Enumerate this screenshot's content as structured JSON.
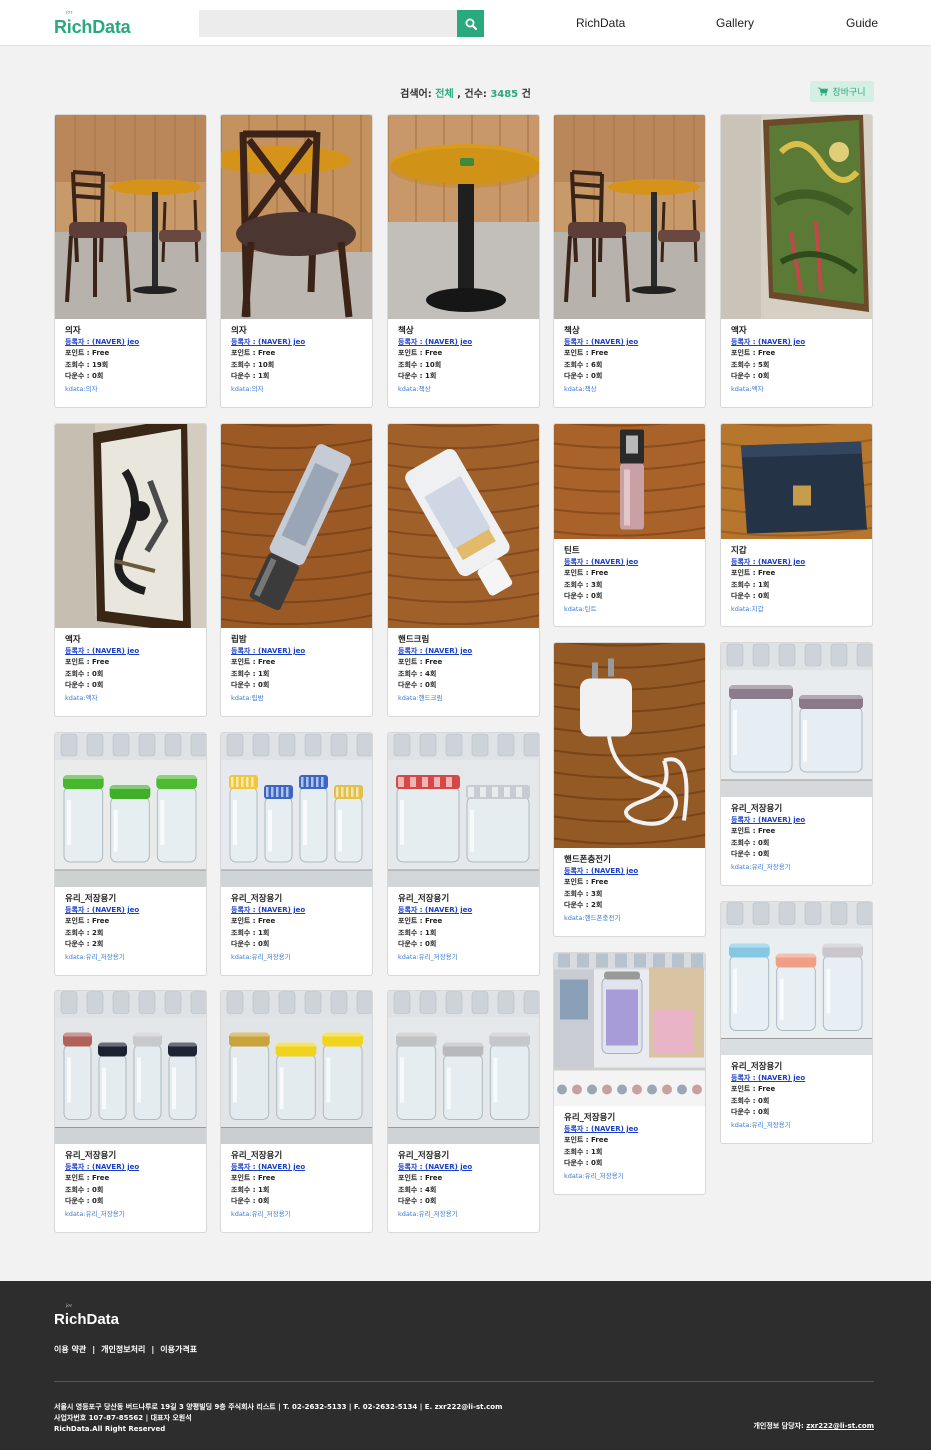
{
  "header": {
    "logo_sprout": "ʲᵒᶦ",
    "logo_text": "RichData",
    "search_placeholder": "",
    "nav": [
      "RichData",
      "Gallery",
      "Guide"
    ]
  },
  "summary": {
    "query_label": "검색어:",
    "query_value": "전체",
    "count_label": ", 건수:",
    "count_value": "3485",
    "count_unit": "건"
  },
  "cart_label": "장바구니",
  "cards": [
    {
      "title": "의자",
      "reg": "등록자 : (NAVER) jeo",
      "point": "포인트 : Free",
      "views": "조회수 : 19회",
      "downloads": "다운수 : 0회",
      "tag": "kdata:의자",
      "photo": "cafe-chair"
    },
    {
      "title": "의자",
      "reg": "등록자 : (NAVER) jeo",
      "point": "포인트 : Free",
      "views": "조회수 : 10회",
      "downloads": "다운수 : 1회",
      "tag": "kdata:의자",
      "photo": "cross-chair"
    },
    {
      "title": "책상",
      "reg": "등록자 : (NAVER) jeo",
      "point": "포인트 : Free",
      "views": "조회수 : 10회",
      "downloads": "다운수 : 1회",
      "tag": "kdata:책상",
      "photo": "round-table"
    },
    {
      "title": "책상",
      "reg": "등록자 : (NAVER) jeo",
      "point": "포인트 : Free",
      "views": "조회수 : 6회",
      "downloads": "다운수 : 0회",
      "tag": "kdata:책상",
      "photo": "cafe-chair"
    },
    {
      "title": "액자",
      "reg": "등록자 : (NAVER) jeo",
      "point": "포인트 : Free",
      "views": "조회수 : 5회",
      "downloads": "다운수 : 0회",
      "tag": "kdata:액자",
      "photo": "painting"
    },
    {
      "title": "액자",
      "reg": "등록자 : (NAVER) jeo",
      "point": "포인트 : Free",
      "views": "조회수 : 0회",
      "downloads": "다운수 : 0회",
      "tag": "kdata:액자",
      "photo": "frame-art"
    },
    {
      "title": "립밤",
      "reg": "등록자 : (NAVER) jeo",
      "point": "포인트 : Free",
      "views": "조회수 : 1회",
      "downloads": "다운수 : 0회",
      "tag": "kdata:립밤",
      "photo": "lip-balm"
    },
    {
      "title": "핸드크림",
      "reg": "등록자 : (NAVER) jeo",
      "point": "포인트 : Free",
      "views": "조회수 : 4회",
      "downloads": "다운수 : 0회",
      "tag": "kdata:핸드크림",
      "photo": "hand-cream"
    },
    {
      "title": "틴트",
      "reg": "등록자 : (NAVER) jeo",
      "point": "포인트 : Free",
      "views": "조회수 : 3회",
      "downloads": "다운수 : 0회",
      "tag": "kdata:틴트",
      "photo": "tint"
    },
    {
      "title": "지갑",
      "reg": "등록자 : (NAVER) jeo",
      "point": "포인트 : Free",
      "views": "조회수 : 1회",
      "downloads": "다운수 : 0회",
      "tag": "kdata:지갑",
      "photo": "wallet"
    },
    {
      "title": "핸드폰충전기",
      "reg": "등록자 : (NAVER) jeo",
      "point": "포인트 : Free",
      "views": "조회수 : 3회",
      "downloads": "다운수 : 2회",
      "tag": "kdata:핸드폰충전기",
      "photo": "charger"
    },
    {
      "title": "유리_저장용기",
      "reg": "등록자 : (NAVER) jeo",
      "point": "포인트 : Free",
      "views": "조회수 : 0회",
      "downloads": "다운수 : 0회",
      "tag": "kdata:유리_저장용기",
      "photo": "jar-purple"
    },
    {
      "title": "유리_저장용기",
      "reg": "등록자 : (NAVER) jeo",
      "point": "포인트 : Free",
      "views": "조회수 : 2회",
      "downloads": "다운수 : 2회",
      "tag": "kdata:유리_저장용기",
      "photo": "jar-green"
    },
    {
      "title": "유리_저장용기",
      "reg": "등록자 : (NAVER) jeo",
      "point": "포인트 : Free",
      "views": "조회수 : 1회",
      "downloads": "다운수 : 0회",
      "tag": "kdata:유리_저장용기",
      "photo": "jar-blue-check"
    },
    {
      "title": "유리_저장용기",
      "reg": "등록자 : (NAVER) jeo",
      "point": "포인트 : Free",
      "views": "조회수 : 1회",
      "downloads": "다운수 : 0회",
      "tag": "kdata:유리_저장용기",
      "photo": "jar-red-check"
    },
    {
      "title": "유리_저장용기",
      "reg": "등록자 : (NAVER) jeo",
      "point": "포인트 : Free",
      "views": "조회수 : 0회",
      "downloads": "다운수 : 0회",
      "tag": "kdata:유리_저장용기",
      "photo": "jar-pastel"
    },
    {
      "title": "유리_저장용기",
      "reg": "등록자 : (NAVER) jeo",
      "point": "포인트 : Free",
      "views": "조회수 : 0회",
      "downloads": "다운수 : 0회",
      "tag": "kdata:유리_저장용기",
      "photo": "jar-metal"
    },
    {
      "title": "유리_저장용기",
      "reg": "등록자 : (NAVER) jeo",
      "point": "포인트 : Free",
      "views": "조회수 : 1회",
      "downloads": "다운수 : 0회",
      "tag": "kdata:유리_저장용기",
      "photo": "jar-yellow"
    },
    {
      "title": "유리_저장용기",
      "reg": "등록자 : (NAVER) jeo",
      "point": "포인트 : Free",
      "views": "조회수 : 4회",
      "downloads": "다운수 : 0회",
      "tag": "kdata:유리_저장용기",
      "photo": "jar-silver"
    },
    {
      "title": "유리_저장용기",
      "reg": "등록자 : (NAVER) jeo",
      "point": "포인트 : Free",
      "views": "조회수 : 1회",
      "downloads": "다운수 : 0회",
      "tag": "kdata:유리_저장용기",
      "photo": "store-shelf"
    }
  ],
  "footer": {
    "logo_sprout": "ʲᵒᶦ",
    "logo_text": "RichData",
    "links": [
      "이용 약관",
      "개인정보처리",
      "이용가격표"
    ],
    "address_line1": "서울시 영등포구 당산동 버드나루로 19길 3 양평빌딩 9층 주식회사 리스트 | T. 02-2632-5133 | F. 02-2632-5134 | E. zxr222@li-st.com",
    "address_line2": "사업자번호 107-87-85562 | 대표자 오원석",
    "address_line3": "RichData.All Right Reserved",
    "contact_label": "개인정보 담당자:",
    "contact_email": "zxr222@li-st.com"
  }
}
